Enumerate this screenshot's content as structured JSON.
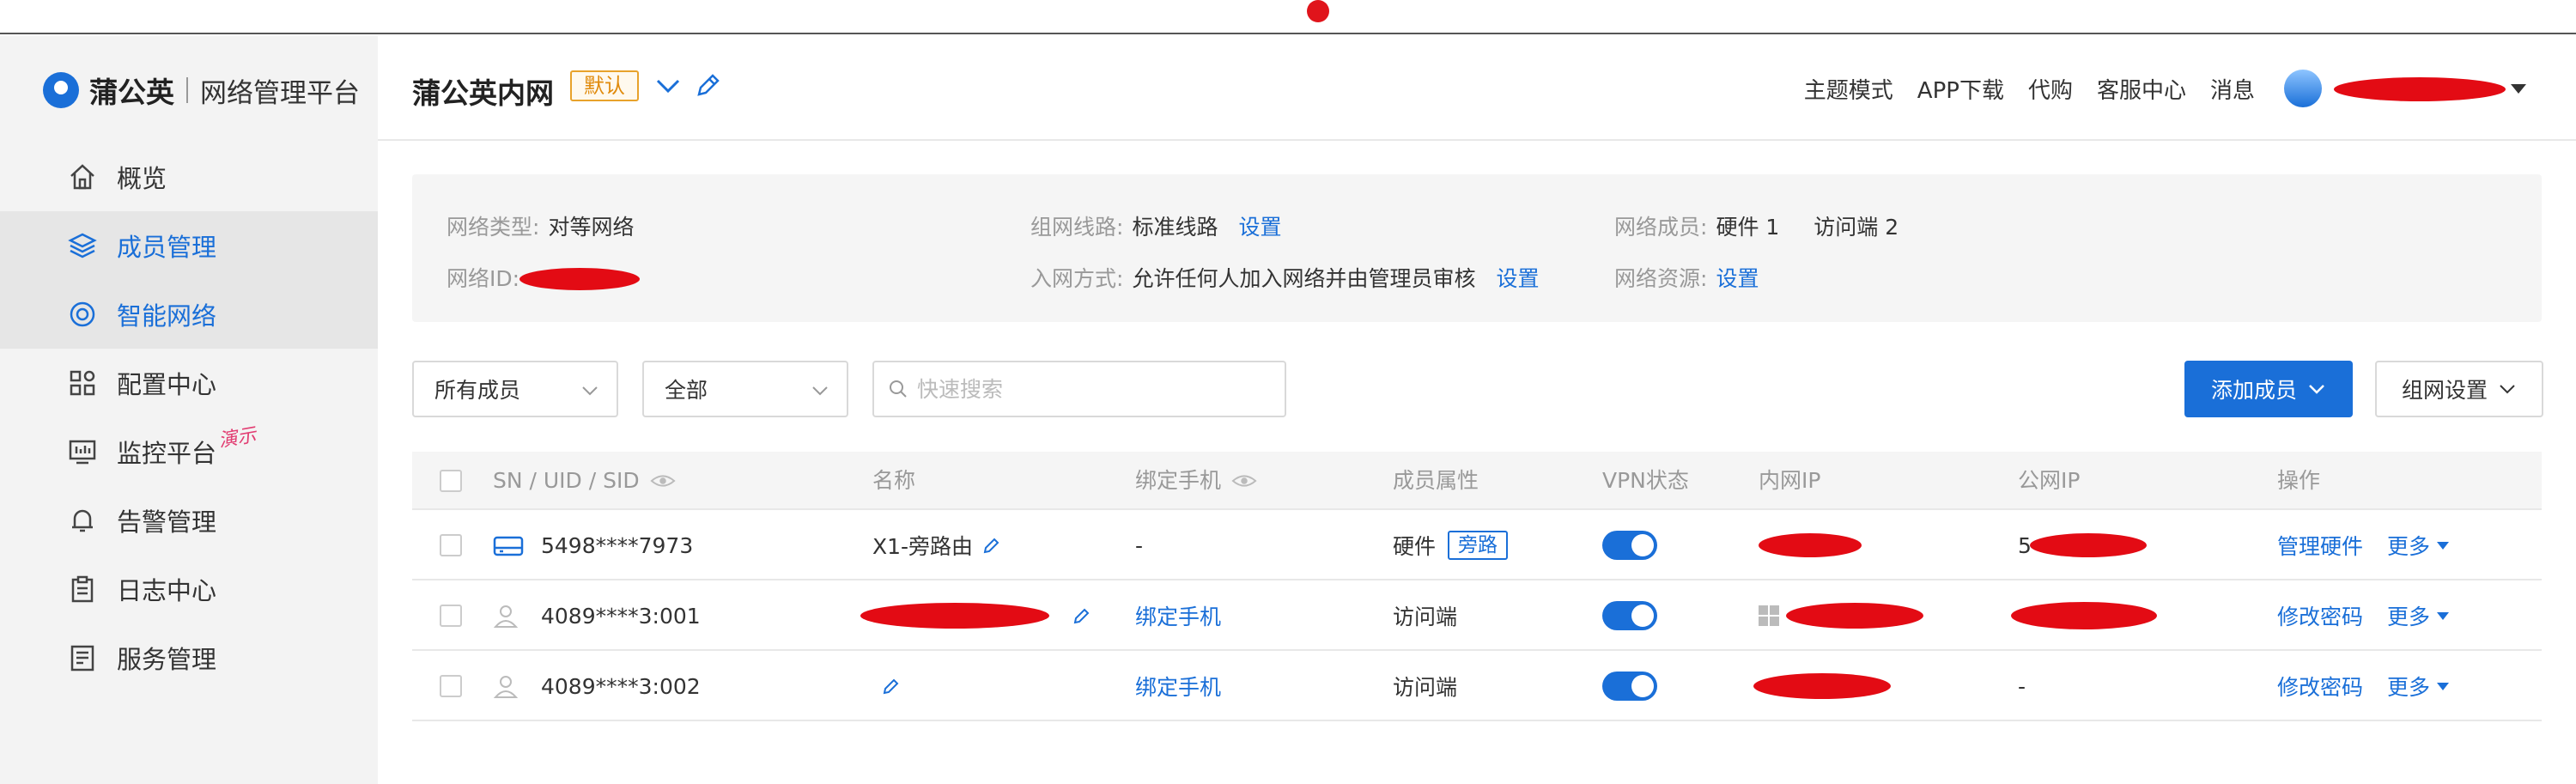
{
  "brand": {
    "name": "蒲公英",
    "subtitle": "网络管理平台"
  },
  "sidebar": {
    "items": [
      {
        "label": "概览",
        "icon": "home-icon",
        "selected": false
      },
      {
        "label": "成员管理",
        "icon": "layers-icon",
        "selected": true
      },
      {
        "label": "智能网络",
        "icon": "network-icon",
        "selected": true
      },
      {
        "label": "配置中心",
        "icon": "grid-icon",
        "selected": false
      },
      {
        "label": "监控平台",
        "icon": "monitor-icon",
        "selected": false,
        "tag": "演示"
      },
      {
        "label": "告警管理",
        "icon": "bell-icon",
        "selected": false
      },
      {
        "label": "日志中心",
        "icon": "clipboard-icon",
        "selected": false
      },
      {
        "label": "服务管理",
        "icon": "document-icon",
        "selected": false
      }
    ]
  },
  "header": {
    "network_name": "蒲公英内网",
    "default_badge": "默认",
    "topnav": [
      "主题模式",
      "APP下载",
      "代购",
      "客服中心",
      "消息"
    ]
  },
  "info": {
    "network_type_label": "网络类型:",
    "network_type": "对等网络",
    "network_id_label": "网络ID:",
    "route_label": "组网线路:",
    "route": "标准线路",
    "route_link": "设置",
    "join_label": "入网方式:",
    "join": "允许任何人加入网络并由管理员审核",
    "join_link": "设置",
    "members_label": "网络成员:",
    "members_hw": "硬件 1",
    "members_client": "访问端 2",
    "resources_label": "网络资源:",
    "resources_link": "设置"
  },
  "filters": {
    "member_filter": "所有成员",
    "status_filter": "全部",
    "search_placeholder": "快速搜索",
    "add_member": "添加成员",
    "net_settings": "组网设置"
  },
  "table": {
    "headers": {
      "sn": "SN / UID / SID",
      "name": "名称",
      "phone": "绑定手机",
      "attr": "成员属性",
      "vpn": "VPN状态",
      "lan_ip": "内网IP",
      "wan_ip": "公网IP",
      "ops": "操作"
    },
    "rows": [
      {
        "sn": "5498****7973",
        "type": "hardware",
        "name": "X1-旁路由",
        "phone": "-",
        "phone_is_link": false,
        "attr": "硬件",
        "attr_tag": "旁路",
        "vpn_on": true,
        "wan_ip": "5",
        "op": "管理硬件",
        "more": "更多"
      },
      {
        "sn": "4089****3:001",
        "type": "client",
        "name": "",
        "phone": "绑定手机",
        "phone_is_link": true,
        "attr": "访问端",
        "attr_tag": "",
        "vpn_on": true,
        "wan_ip": "",
        "op": "修改密码",
        "more": "更多"
      },
      {
        "sn": "4089****3:002",
        "type": "client",
        "name": "",
        "phone": "绑定手机",
        "phone_is_link": true,
        "attr": "访问端",
        "attr_tag": "",
        "vpn_on": true,
        "wan_ip": "-",
        "op": "修改密码",
        "more": "更多"
      }
    ]
  },
  "colors": {
    "accent": "#1a6fd8",
    "badge": "#e8a22b",
    "redaction": "#e30b14",
    "demo_tag": "#e23d72"
  }
}
